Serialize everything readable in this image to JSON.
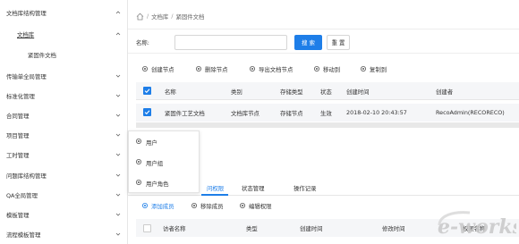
{
  "sidebar": {
    "items": [
      {
        "label": "文档库结构管理",
        "chevron": "up"
      },
      {
        "label": "文档库",
        "chevron": "up"
      },
      {
        "label": "紧固件文档",
        "chevron": ""
      },
      {
        "label": "传输单全局管理",
        "chevron": "down"
      },
      {
        "label": "标准化管理",
        "chevron": "down"
      },
      {
        "label": "合同管理",
        "chevron": "down"
      },
      {
        "label": "项目管理",
        "chevron": "down"
      },
      {
        "label": "工时管理",
        "chevron": "down"
      },
      {
        "label": "问题库结构管理",
        "chevron": "down"
      },
      {
        "label": "QA全局管理",
        "chevron": "down"
      },
      {
        "label": "模板管理",
        "chevron": "down"
      },
      {
        "label": "流程模板管理",
        "chevron": "down"
      }
    ]
  },
  "breadcrumb": {
    "items": [
      "文档库",
      "紧固件文档"
    ],
    "separator": "/"
  },
  "search": {
    "label": "名称:",
    "value": "",
    "placeholder": "",
    "search_button": "搜 索",
    "reset_button": "重 置"
  },
  "toolbar": {
    "create_node": "创建节点",
    "delete_node": "删除节点",
    "export_doc_node": "导出文档节点",
    "move_to": "移动到",
    "copy_to": "复制到"
  },
  "table": {
    "headers": {
      "name": "名称",
      "category": "类别",
      "storage_type": "存储类型",
      "status": "状态",
      "created_time": "创建时间",
      "creator": "创建者"
    },
    "rows": [
      {
        "name": "紧固件工艺文档",
        "category": "文档库节点",
        "storage_type": "存储节点",
        "status": "生效",
        "created_time": "2018-02-10 20:43:57",
        "creator": "RecoAdmin(RECORECO)"
      }
    ]
  },
  "popup": {
    "items": [
      {
        "label": "用户",
        "icon": "gear-icon"
      },
      {
        "label": "用户组",
        "icon": "gear-icon"
      },
      {
        "label": "用户角色",
        "icon": "gear-icon"
      }
    ]
  },
  "tabs": {
    "items": [
      "访问权限",
      "状态管理",
      "操作记录"
    ],
    "active_label_visible": "问权限",
    "active": 0
  },
  "member_tools": {
    "add_member": "添加成员",
    "remove_member": "移除成员",
    "edit_permission": "编辑权限"
  },
  "member_table": {
    "headers": {
      "visitor_name": "访者名称",
      "type": "类型",
      "created_time": "创建时间",
      "modified_time": "修改时间",
      "action": "权限名称"
    }
  },
  "watermark": {
    "text": "e-works"
  },
  "colors": {
    "accent": "#1e7ee8",
    "row_bg": "#f5f6f8",
    "watermark": "#c8c8c8"
  }
}
